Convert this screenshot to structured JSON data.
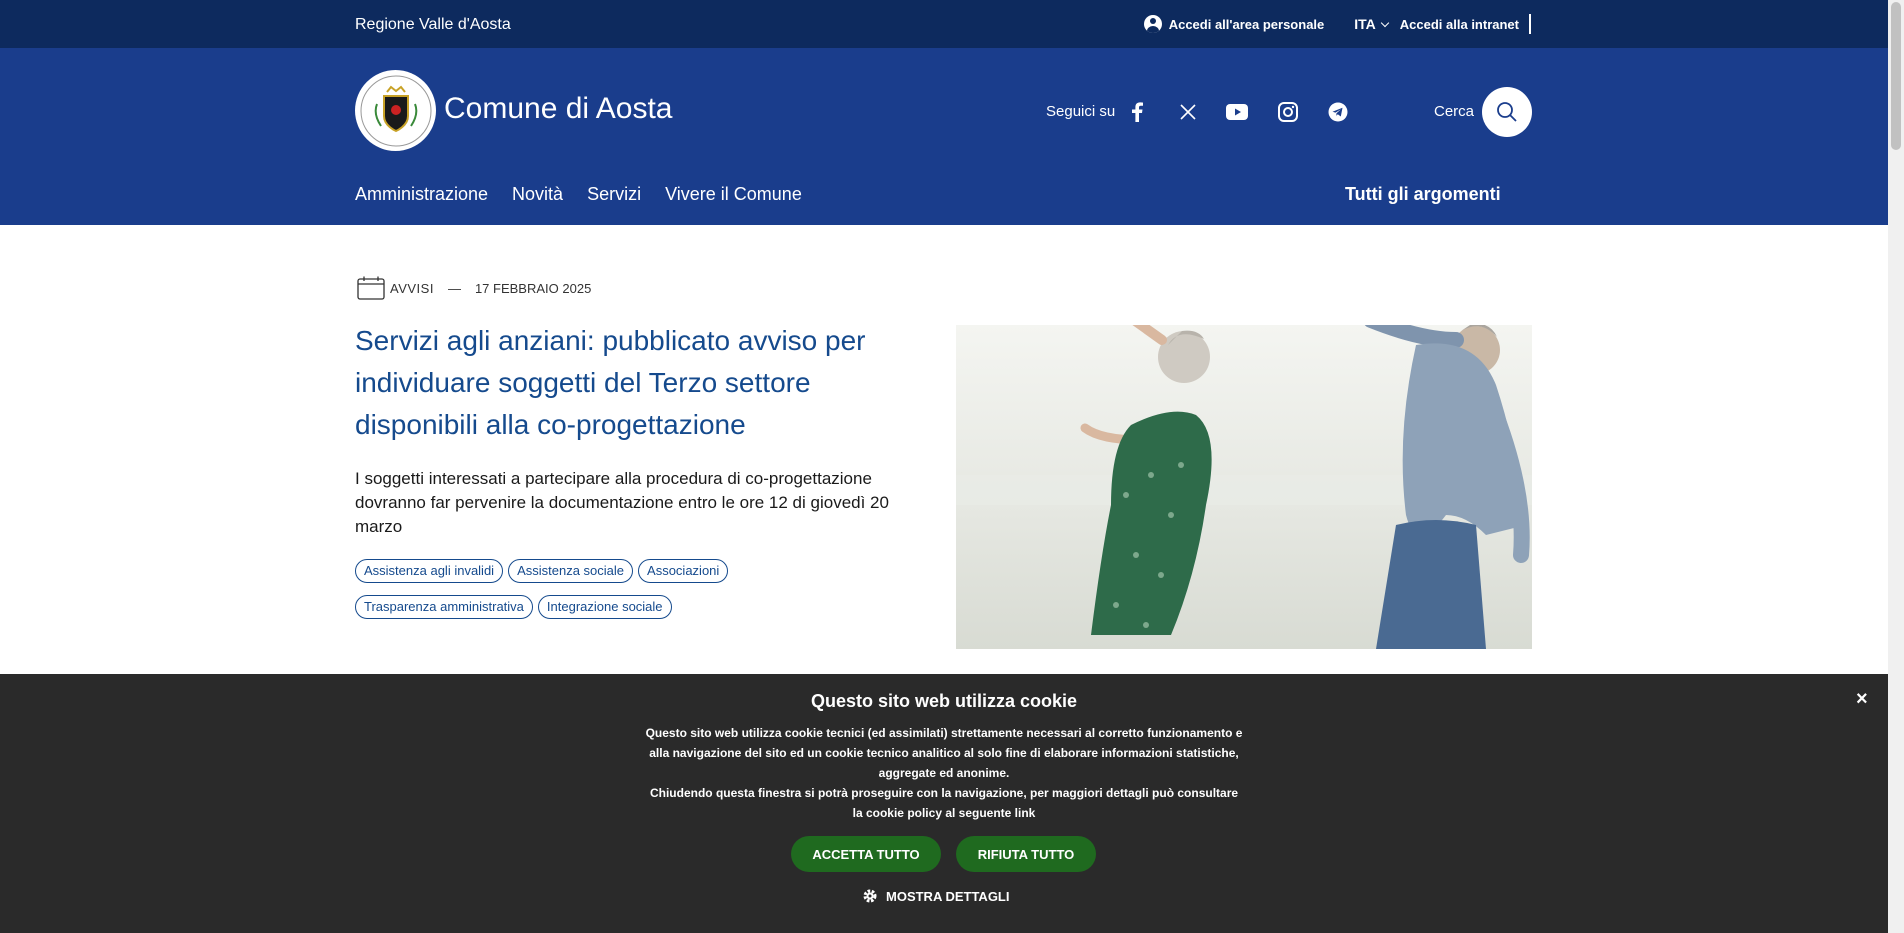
{
  "topbar": {
    "region": "Regione Valle d'Aosta",
    "personal_area": "Accedi all'area personale",
    "language": "ITA",
    "intranet": "Accedi alla intranet"
  },
  "header": {
    "title": "Comune di Aosta",
    "follow_label": "Seguici su",
    "social": [
      "facebook-icon",
      "x-icon",
      "youtube-icon",
      "instagram-icon",
      "telegram-icon"
    ],
    "search_label": "Cerca"
  },
  "nav": {
    "items": [
      "Amministrazione",
      "Novità",
      "Servizi",
      "Vivere il Comune"
    ],
    "topics": "Tutti gli argomenti"
  },
  "article": {
    "category": "AVVISI",
    "separator": "—",
    "date": "17 FEBBRAIO 2025",
    "title": "Servizi agli anziani: pubblicato avviso per individuare soggetti del Terzo settore disponibili alla co-progettazione",
    "summary": "I soggetti interessati a partecipare alla procedura di co-progettazione dovranno far pervenire la documentazione entro le ore 12 di giovedì 20 marzo",
    "tags": [
      "Assistenza agli invalidi",
      "Assistenza sociale",
      "Associazioni",
      "Trasparenza amministrativa",
      "Integrazione sociale"
    ]
  },
  "cookie": {
    "title": "Questo sito web utilizza cookie",
    "text1": "Questo sito web utilizza cookie tecnici (ed assimilati) strettamente necessari al corretto funzionamento e alla navigazione del sito ed un cookie tecnico analitico al solo fine di elaborare informazioni statistiche, aggregate ed anonime.",
    "text2": "Chiudendo questa finestra si potrà proseguire con la navigazione, per maggiori dettagli può consultare la cookie policy al seguente link",
    "accept": "ACCETTA TUTTO",
    "reject": "RIFIUTA TUTTO",
    "details": "MOSTRA DETTAGLI",
    "close": "×"
  },
  "colors": {
    "topbar": "#0d2a5e",
    "header": "#1a3d8c",
    "title_blue": "#154a8d",
    "cookie_bg": "#2a2a2a",
    "button_green": "#1f6a1f"
  }
}
